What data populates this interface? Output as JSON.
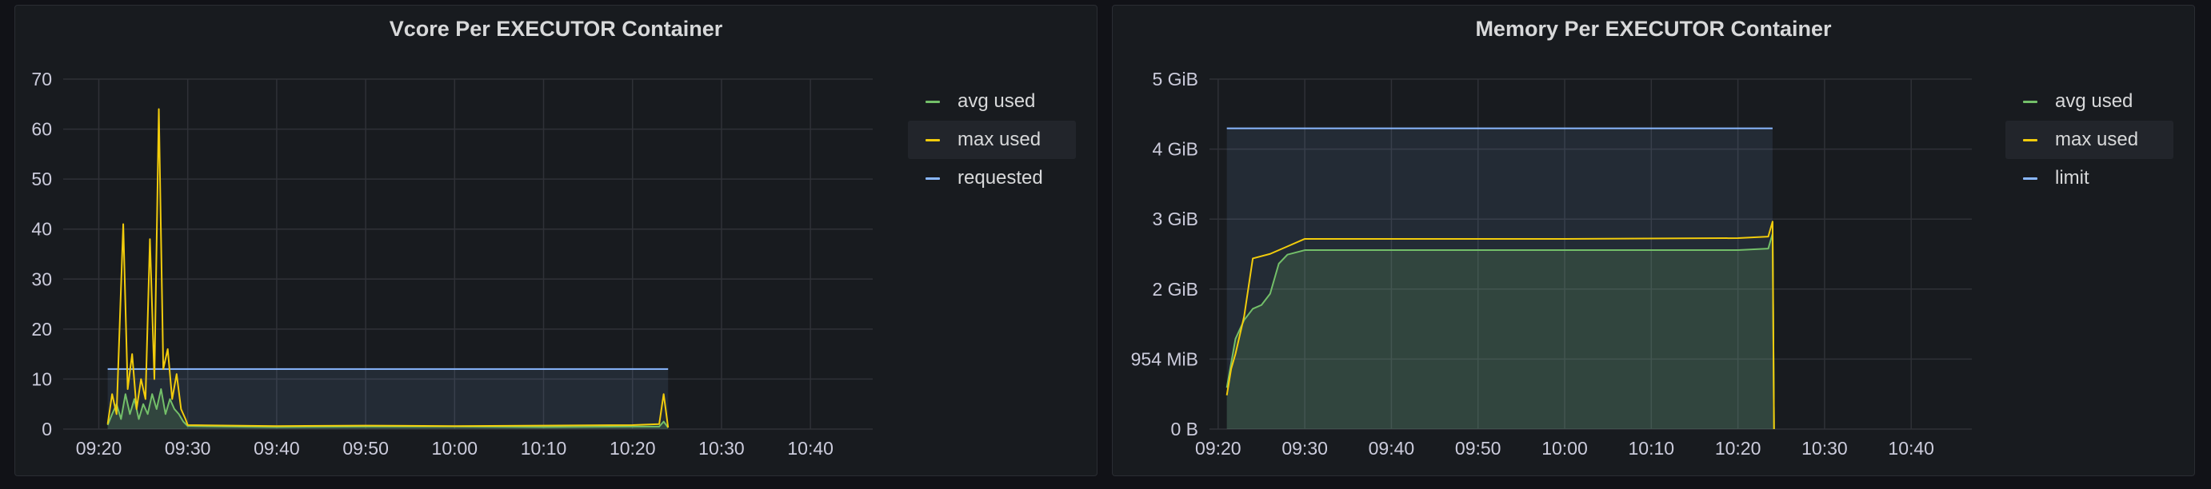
{
  "dashboard": {
    "panels": [
      {
        "title": "Vcore Per EXECUTOR Container",
        "legend": [
          {
            "label": "avg used",
            "color": "#73BF69"
          },
          {
            "label": "max used",
            "color": "#F2CC0C"
          },
          {
            "label": "requested",
            "color": "#8AB8FF"
          }
        ]
      },
      {
        "title": "Memory Per EXECUTOR Container",
        "legend": [
          {
            "label": "avg used",
            "color": "#73BF69"
          },
          {
            "label": "max used",
            "color": "#F2CC0C"
          },
          {
            "label": "limit",
            "color": "#8AB8FF"
          }
        ]
      }
    ]
  },
  "chart_data": [
    {
      "type": "line",
      "title": "Vcore Per EXECUTOR Container",
      "x_tick_labels": [
        "09:20",
        "09:30",
        "09:40",
        "09:50",
        "10:00",
        "10:10",
        "10:20",
        "10:30",
        "10:40"
      ],
      "x_range": [
        "09:16",
        "10:47"
      ],
      "y_tick_labels": [
        "0",
        "10",
        "20",
        "30",
        "40",
        "50",
        "60",
        "70"
      ],
      "ylim": [
        0,
        70
      ],
      "grid": true,
      "legend_placement": "right",
      "series": [
        {
          "name": "avg used",
          "color": "#73BF69",
          "fill": true,
          "points": [
            [
              "09:21:00",
              0.8
            ],
            [
              "09:21:30",
              3
            ],
            [
              "09:22:00",
              5
            ],
            [
              "09:22:30",
              2
            ],
            [
              "09:23:00",
              7
            ],
            [
              "09:23:30",
              3
            ],
            [
              "09:24:00",
              6
            ],
            [
              "09:24:30",
              2
            ],
            [
              "09:25:00",
              5
            ],
            [
              "09:25:30",
              3
            ],
            [
              "09:26:00",
              7
            ],
            [
              "09:26:30",
              4
            ],
            [
              "09:27:00",
              8
            ],
            [
              "09:27:30",
              3
            ],
            [
              "09:28:00",
              6
            ],
            [
              "09:28:30",
              4
            ],
            [
              "09:29:00",
              3
            ],
            [
              "09:29:30",
              1.5
            ],
            [
              "09:30:00",
              0.6
            ],
            [
              "09:40:00",
              0.4
            ],
            [
              "09:50:00",
              0.5
            ],
            [
              "10:00:00",
              0.5
            ],
            [
              "10:10:00",
              0.4
            ],
            [
              "10:20:00",
              0.5
            ],
            [
              "10:23:00",
              0.5
            ],
            [
              "10:23:30",
              1.5
            ],
            [
              "10:24:00",
              0.3
            ]
          ]
        },
        {
          "name": "max used",
          "color": "#F2CC0C",
          "fill": false,
          "points": [
            [
              "09:21:00",
              1
            ],
            [
              "09:21:30",
              7
            ],
            [
              "09:22:00",
              3
            ],
            [
              "09:22:45",
              41
            ],
            [
              "09:23:15",
              8
            ],
            [
              "09:23:45",
              15
            ],
            [
              "09:24:15",
              4
            ],
            [
              "09:24:45",
              10
            ],
            [
              "09:25:15",
              6
            ],
            [
              "09:25:45",
              38
            ],
            [
              "09:26:15",
              10
            ],
            [
              "09:26:45",
              64
            ],
            [
              "09:27:15",
              12
            ],
            [
              "09:27:45",
              16
            ],
            [
              "09:28:15",
              6
            ],
            [
              "09:28:45",
              11
            ],
            [
              "09:29:15",
              4
            ],
            [
              "09:29:45",
              2
            ],
            [
              "09:30:00",
              0.8
            ],
            [
              "09:40:00",
              0.6
            ],
            [
              "09:50:00",
              0.7
            ],
            [
              "10:00:00",
              0.6
            ],
            [
              "10:10:00",
              0.7
            ],
            [
              "10:20:00",
              0.8
            ],
            [
              "10:23:00",
              1
            ],
            [
              "10:23:30",
              7
            ],
            [
              "10:24:00",
              0.3
            ]
          ]
        },
        {
          "name": "requested",
          "color": "#8AB8FF",
          "fill": true,
          "points": [
            [
              "09:21:00",
              12
            ],
            [
              "10:24:00",
              12
            ]
          ]
        }
      ]
    },
    {
      "type": "line",
      "title": "Memory Per EXECUTOR Container",
      "x_tick_labels": [
        "09:20",
        "09:30",
        "09:40",
        "09:50",
        "10:00",
        "10:10",
        "10:20",
        "10:30",
        "10:40"
      ],
      "x_range": [
        "09:19",
        "10:47"
      ],
      "y_tick_labels": [
        "0 B",
        "954 MiB",
        "2 GiB",
        "3 GiB",
        "4 GiB",
        "5 GiB"
      ],
      "y_unit": "GiB",
      "y_tick_values": [
        0,
        0.931,
        1.862,
        2.793,
        3.724,
        4.655
      ],
      "ylim": [
        0,
        4.655
      ],
      "grid": true,
      "legend_placement": "right",
      "series": [
        {
          "name": "avg used",
          "color": "#73BF69",
          "fill": true,
          "points": [
            [
              "09:21:00",
              0.55
            ],
            [
              "09:22:00",
              1.2
            ],
            [
              "09:23:00",
              1.45
            ],
            [
              "09:24:00",
              1.6
            ],
            [
              "09:25:00",
              1.65
            ],
            [
              "09:26:00",
              1.8
            ],
            [
              "09:27:00",
              2.2
            ],
            [
              "09:28:00",
              2.32
            ],
            [
              "09:30:00",
              2.38
            ],
            [
              "09:40:00",
              2.38
            ],
            [
              "10:00:00",
              2.38
            ],
            [
              "10:20:00",
              2.38
            ],
            [
              "10:23:30",
              2.4
            ],
            [
              "10:24:00",
              2.6
            ],
            [
              "10:24:10",
              0
            ]
          ]
        },
        {
          "name": "max used",
          "color": "#F2CC0C",
          "fill": false,
          "points": [
            [
              "09:21:00",
              0.45
            ],
            [
              "09:21:30",
              0.8
            ],
            [
              "09:22:00",
              1.0
            ],
            [
              "09:23:00",
              1.5
            ],
            [
              "09:24:00",
              2.27
            ],
            [
              "09:26:00",
              2.33
            ],
            [
              "09:28:00",
              2.43
            ],
            [
              "09:30:00",
              2.53
            ],
            [
              "09:40:00",
              2.53
            ],
            [
              "10:00:00",
              2.53
            ],
            [
              "10:20:00",
              2.54
            ],
            [
              "10:23:30",
              2.56
            ],
            [
              "10:24:00",
              2.76
            ],
            [
              "10:24:10",
              0
            ]
          ]
        },
        {
          "name": "limit",
          "color": "#8AB8FF",
          "fill": true,
          "points": [
            [
              "09:21:00",
              4.0
            ],
            [
              "10:24:00",
              4.0
            ]
          ]
        }
      ]
    }
  ]
}
